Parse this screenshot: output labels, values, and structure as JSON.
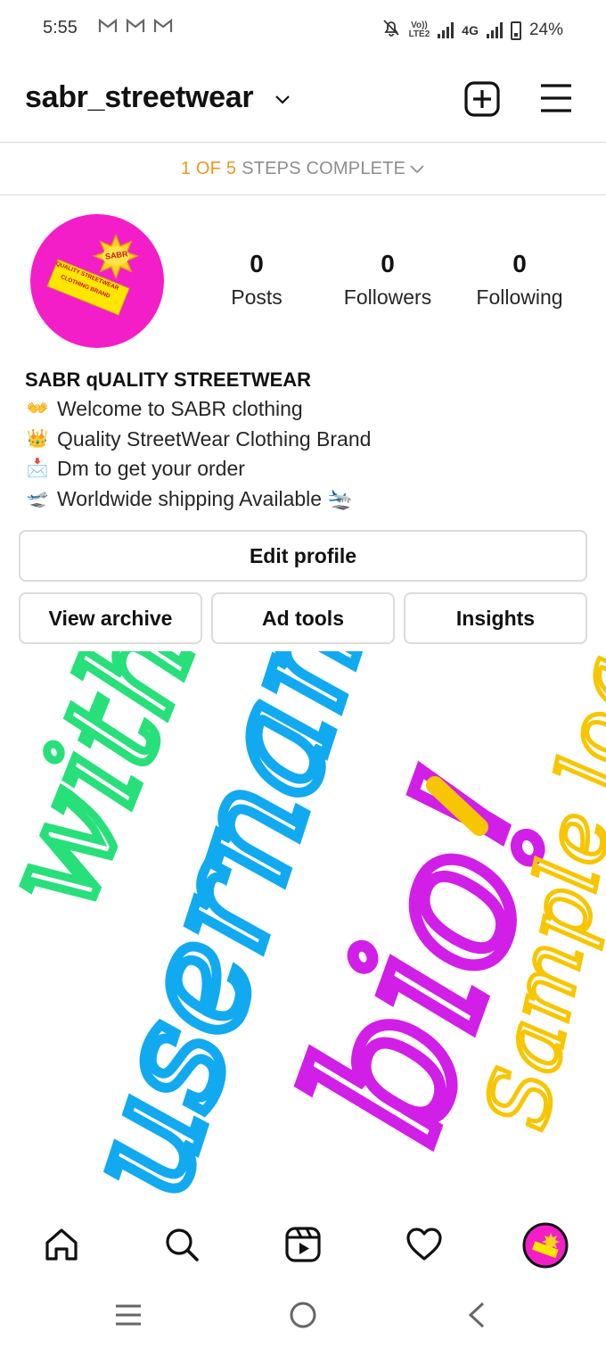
{
  "status_bar": {
    "time": "5:55",
    "notification_icons": [
      "gmail-icon",
      "gmail-icon",
      "gmail-icon"
    ],
    "volte_top": "Vo))",
    "volte_bottom": "LTE2",
    "network": "4G",
    "battery": "24%"
  },
  "header": {
    "username": "sabr_streetwear"
  },
  "steps_banner": {
    "progress": "1 OF 5",
    "text": "STEPS COMPLETE"
  },
  "profile": {
    "avatar_badge": "SABR",
    "avatar_sign_line1": "QUALITY STREETWEAR",
    "avatar_sign_line2": "CLOTHING BRAND",
    "stats": [
      {
        "value": "0",
        "label": "Posts"
      },
      {
        "value": "0",
        "label": "Followers"
      },
      {
        "value": "0",
        "label": "Following"
      }
    ],
    "display_name": "SABR qUALITY STREETWEAR",
    "bio_lines": [
      {
        "emoji": "👐",
        "text": "Welcome to SABR clothing"
      },
      {
        "emoji": "👑",
        "text": "Quality StreetWear Clothing Brand"
      },
      {
        "emoji": "📩",
        "text": "Dm to get your order"
      },
      {
        "emoji": "🛫",
        "text": "Worldwide shipping Available 🛬"
      }
    ]
  },
  "buttons": {
    "edit_profile": "Edit profile",
    "view_archive": "View archive",
    "ad_tools": "Ad tools",
    "insights": "Insights"
  },
  "artwork": {
    "word_green": "with",
    "word_blue": "username!",
    "word_pink": "bio!",
    "word_yellow": "Sample logo",
    "colors": {
      "green": "#27e07a",
      "blue": "#11aaf0",
      "pink": "#d11fe8",
      "yellow": "#f7c600"
    }
  },
  "bottom_nav": [
    "home-icon",
    "search-icon",
    "reels-icon",
    "heart-icon",
    "profile-avatar"
  ],
  "system_nav": [
    "recents-icon",
    "home-circle-icon",
    "back-icon"
  ],
  "colors": {
    "accent_orange": "#f0961e",
    "avatar_magenta": "#f31ec8",
    "border": "#dbdbdb"
  }
}
